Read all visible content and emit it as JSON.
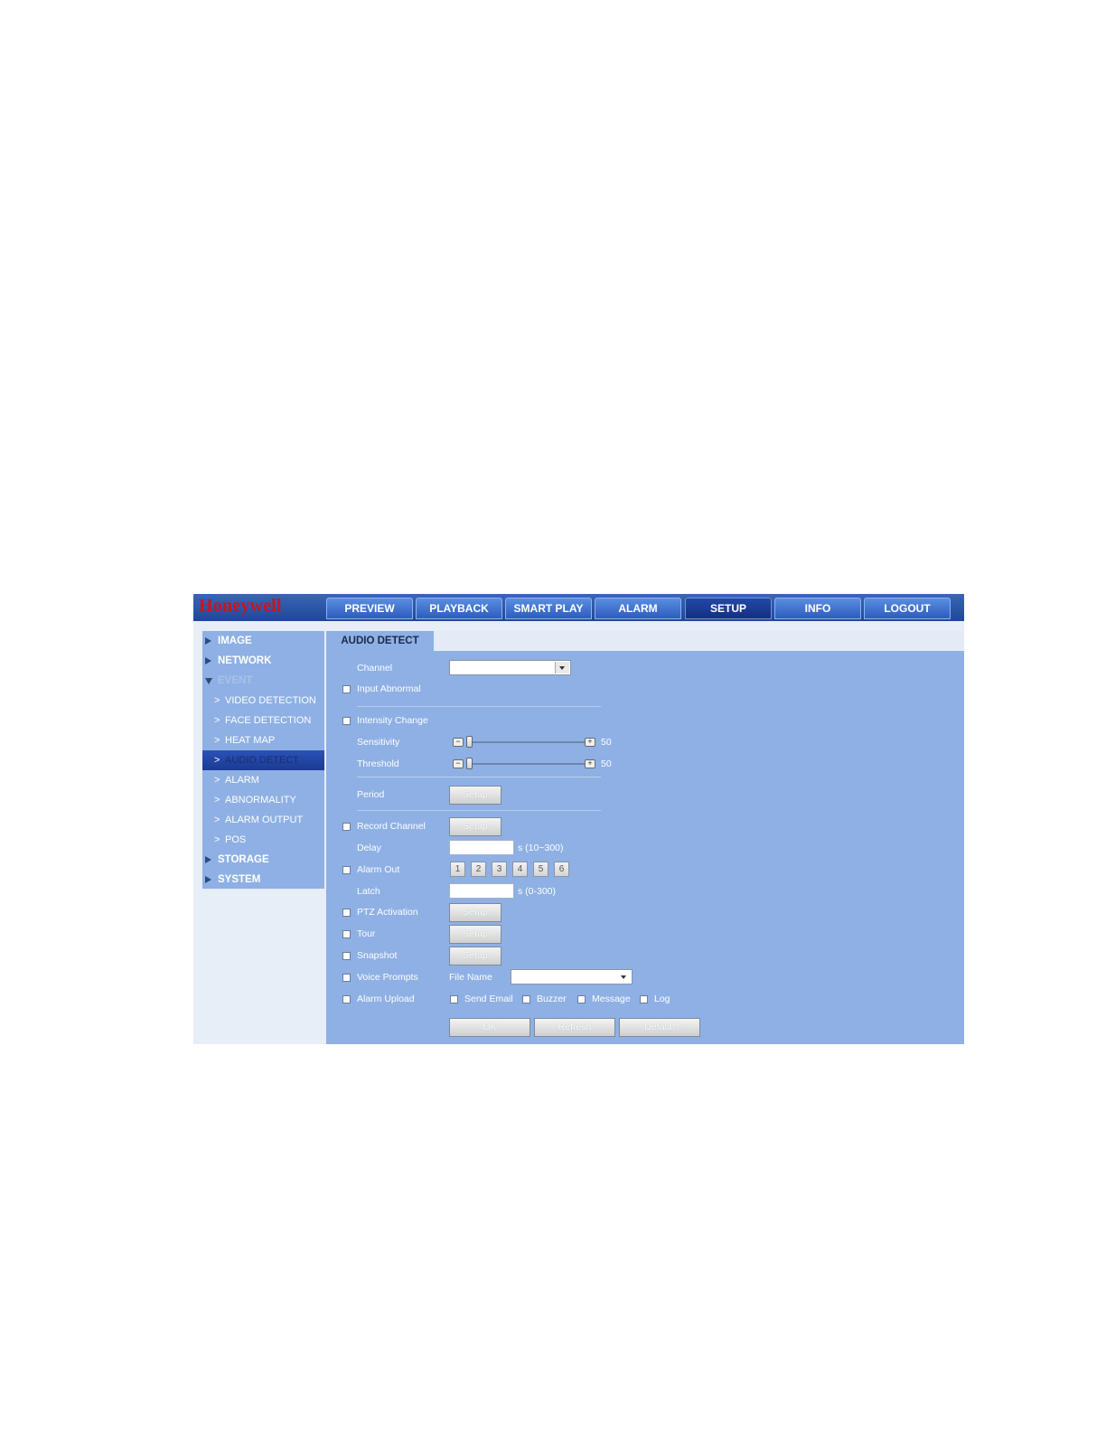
{
  "brand": {
    "logo": "Honeywell"
  },
  "topnav": {
    "tabs": [
      {
        "label": "PREVIEW"
      },
      {
        "label": "PLAYBACK"
      },
      {
        "label": "SMART PLAY"
      },
      {
        "label": "ALARM"
      },
      {
        "label": "SETUP",
        "active": true
      },
      {
        "label": "INFO"
      },
      {
        "label": "LOGOUT"
      }
    ]
  },
  "sidebar": {
    "items": [
      {
        "label": "IMAGE"
      },
      {
        "label": "NETWORK"
      },
      {
        "label": "EVENT",
        "expanded": true
      },
      {
        "label": "VIDEO DETECTION"
      },
      {
        "label": "FACE DETECTION"
      },
      {
        "label": "HEAT MAP"
      },
      {
        "label": "AUDIO DETECT",
        "active": true
      },
      {
        "label": "ALARM"
      },
      {
        "label": "ABNORMALITY"
      },
      {
        "label": "ALARM OUTPUT"
      },
      {
        "label": "POS"
      },
      {
        "label": "STORAGE"
      },
      {
        "label": "SYSTEM"
      }
    ]
  },
  "panel": {
    "tab_title": "AUDIO DETECT",
    "channel_label": "Channel",
    "channel_value": "",
    "input_abnormal_label": "Input Abnormal",
    "intensity_change_label": "Intensity Change",
    "sensitivity_label": "Sensitivity",
    "sensitivity_value": "50",
    "sensitivity_level": 0.05,
    "threshold_label": "Threshold",
    "threshold_value": "50",
    "threshold_level": 0.05,
    "period_label": "Period",
    "setup_label": "Setup",
    "record_channel_label": "Record Channel",
    "delay_label": "Delay",
    "delay_value": "",
    "delay_range": "s (10~300)",
    "alarm_out_label": "Alarm Out",
    "alarm_out_channels": [
      "1",
      "2",
      "3",
      "4",
      "5",
      "6"
    ],
    "latch_label": "Latch",
    "latch_value": "",
    "latch_range": "s (0-300)",
    "ptz_label": "PTZ Activation",
    "tour_label": "Tour",
    "snapshot_label": "Snapshot",
    "voice_prompts_label": "Voice Prompts",
    "file_name_label": "File Name",
    "file_name_value": "",
    "alarm_upload_label": "Alarm Upload",
    "send_email_label": "Send Email",
    "buzzer_label": "Buzzer",
    "message_label": "Message",
    "log_label": "Log",
    "ok_label": "OK",
    "refresh_label": "Refresh",
    "default_label": "Default"
  },
  "colors": {
    "topbar": "#1f4796",
    "panel": "#8eb0e4",
    "logo": "#c8141e",
    "active_tab": "#152f82"
  }
}
